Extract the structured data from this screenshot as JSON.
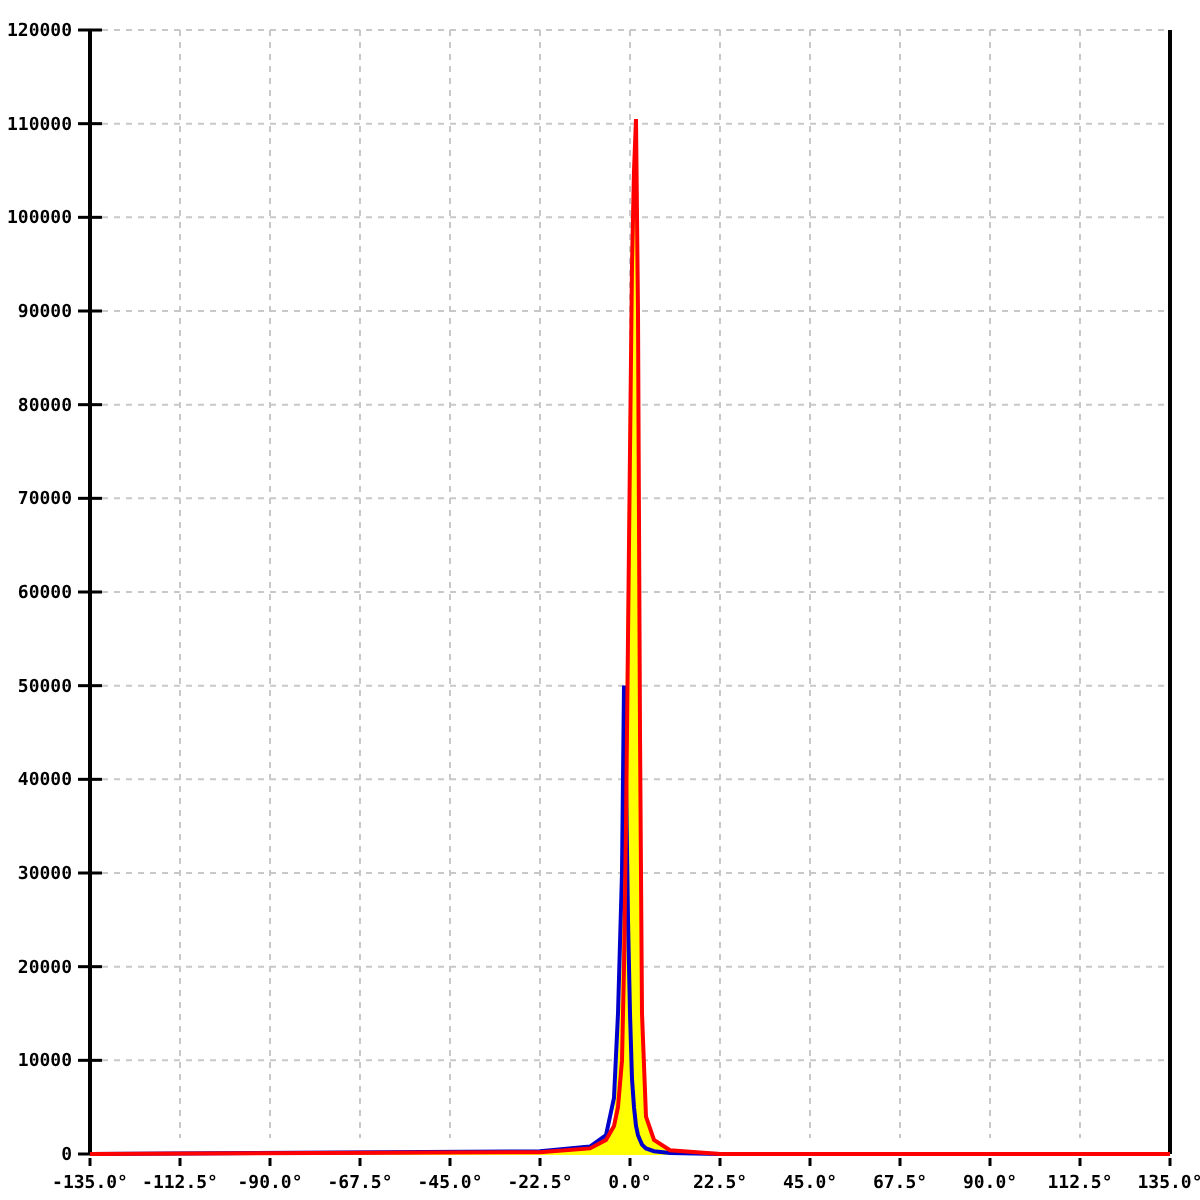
{
  "chart_data": {
    "type": "line",
    "grid": true,
    "xlim": [
      -135,
      135
    ],
    "ylim": [
      0,
      120000
    ],
    "xticks": [
      {
        "value": -135,
        "label": "-135.0°"
      },
      {
        "value": -112.5,
        "label": "-112.5°"
      },
      {
        "value": -90,
        "label": "-90.0°"
      },
      {
        "value": -67.5,
        "label": "-67.5°"
      },
      {
        "value": -45,
        "label": "-45.0°"
      },
      {
        "value": -22.5,
        "label": "-22.5°"
      },
      {
        "value": 0,
        "label": "0.0°"
      },
      {
        "value": 22.5,
        "label": "22.5°"
      },
      {
        "value": 45,
        "label": "45.0°"
      },
      {
        "value": 67.5,
        "label": "67.5°"
      },
      {
        "value": 90,
        "label": "90.0°"
      },
      {
        "value": 112.5,
        "label": "112.5°"
      },
      {
        "value": 135,
        "label": "135.0°"
      }
    ],
    "yticks": [
      0,
      10000,
      20000,
      30000,
      40000,
      50000,
      60000,
      70000,
      80000,
      90000,
      100000,
      110000,
      120000
    ],
    "x": [
      -135,
      -22.5,
      -10,
      -6,
      -4,
      -3,
      -2,
      -1.5,
      -1,
      -0.5,
      0,
      0.5,
      1,
      1.5,
      2,
      2.5,
      3,
      4,
      6,
      10,
      22.5,
      135
    ],
    "series": [
      {
        "type": "area",
        "color": "#ffff00",
        "values": [
          0,
          100,
          400,
          1200,
          3000,
          8000,
          18000,
          30000,
          45000,
          60000,
          80000,
          95000,
          105000,
          90000,
          60000,
          25000,
          8000,
          4000,
          1500,
          200,
          0,
          0
        ]
      },
      {
        "type": "line",
        "color": "#0000cc",
        "values": [
          0,
          300,
          800,
          2000,
          6000,
          15000,
          30000,
          50000,
          40000,
          25000,
          15000,
          8000,
          5000,
          3000,
          2000,
          1500,
          1000,
          600,
          300,
          100,
          0,
          0
        ]
      },
      {
        "type": "line",
        "color": "#ff0000",
        "values": [
          0,
          200,
          600,
          1500,
          3000,
          5000,
          10000,
          20000,
          35000,
          55000,
          75000,
          95000,
          105000,
          110500,
          90000,
          45000,
          15000,
          4000,
          1500,
          400,
          0,
          0
        ]
      }
    ]
  }
}
